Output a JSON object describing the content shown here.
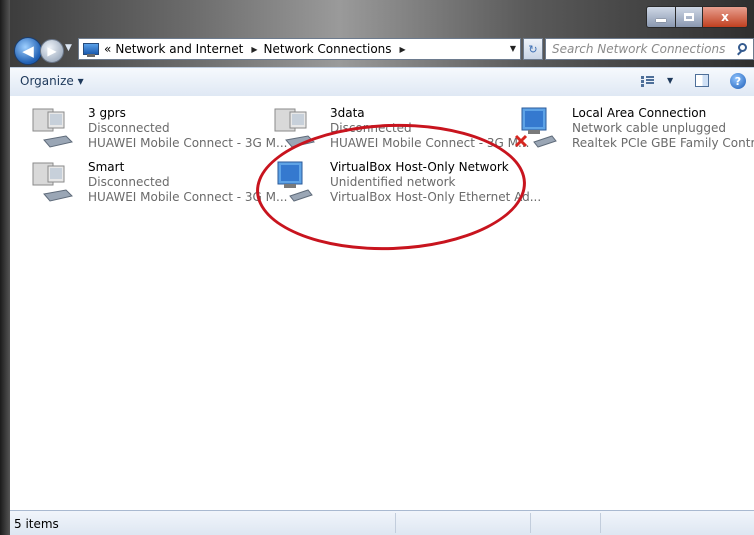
{
  "window": {
    "title_bar": {
      "minimize_glyph": "–",
      "maximize_glyph": "□",
      "close_glyph": "x"
    }
  },
  "navigation": {
    "back_glyph": "◀",
    "forward_glyph": "▶",
    "breadcrumb_prefix": "«",
    "breadcrumbs": [
      "Network and Internet",
      "Network Connections"
    ],
    "refresh_glyph": "↻"
  },
  "search": {
    "placeholder": "Search Network Connections"
  },
  "toolbar": {
    "organize_label": "Organize ▾",
    "help_glyph": "?"
  },
  "connections": [
    {
      "name": "3 gprs",
      "status": "Disconnected",
      "device": "HUAWEI Mobile Connect - 3G M...",
      "icon": "modem-icon"
    },
    {
      "name": "3data",
      "status": "Disconnected",
      "device": "HUAWEI Mobile Connect - 3G M...",
      "icon": "modem-icon"
    },
    {
      "name": "Local Area Connection",
      "status": "Network cable unplugged",
      "device": "Realtek PCIe GBE Family Controller",
      "icon": "ethernet-unplugged-icon"
    },
    {
      "name": "Smart",
      "status": "Disconnected",
      "device": "HUAWEI Mobile Connect - 3G M...",
      "icon": "modem-icon"
    },
    {
      "name": "VirtualBox Host-Only Network",
      "status": "Unidentified network",
      "device": "VirtualBox Host-Only Ethernet Ad...",
      "icon": "ethernet-icon"
    }
  ],
  "status_bar": {
    "item_count": "5 items"
  },
  "colors": {
    "annotation": "#c8141e",
    "secondary_text": "#6a6a6a"
  }
}
